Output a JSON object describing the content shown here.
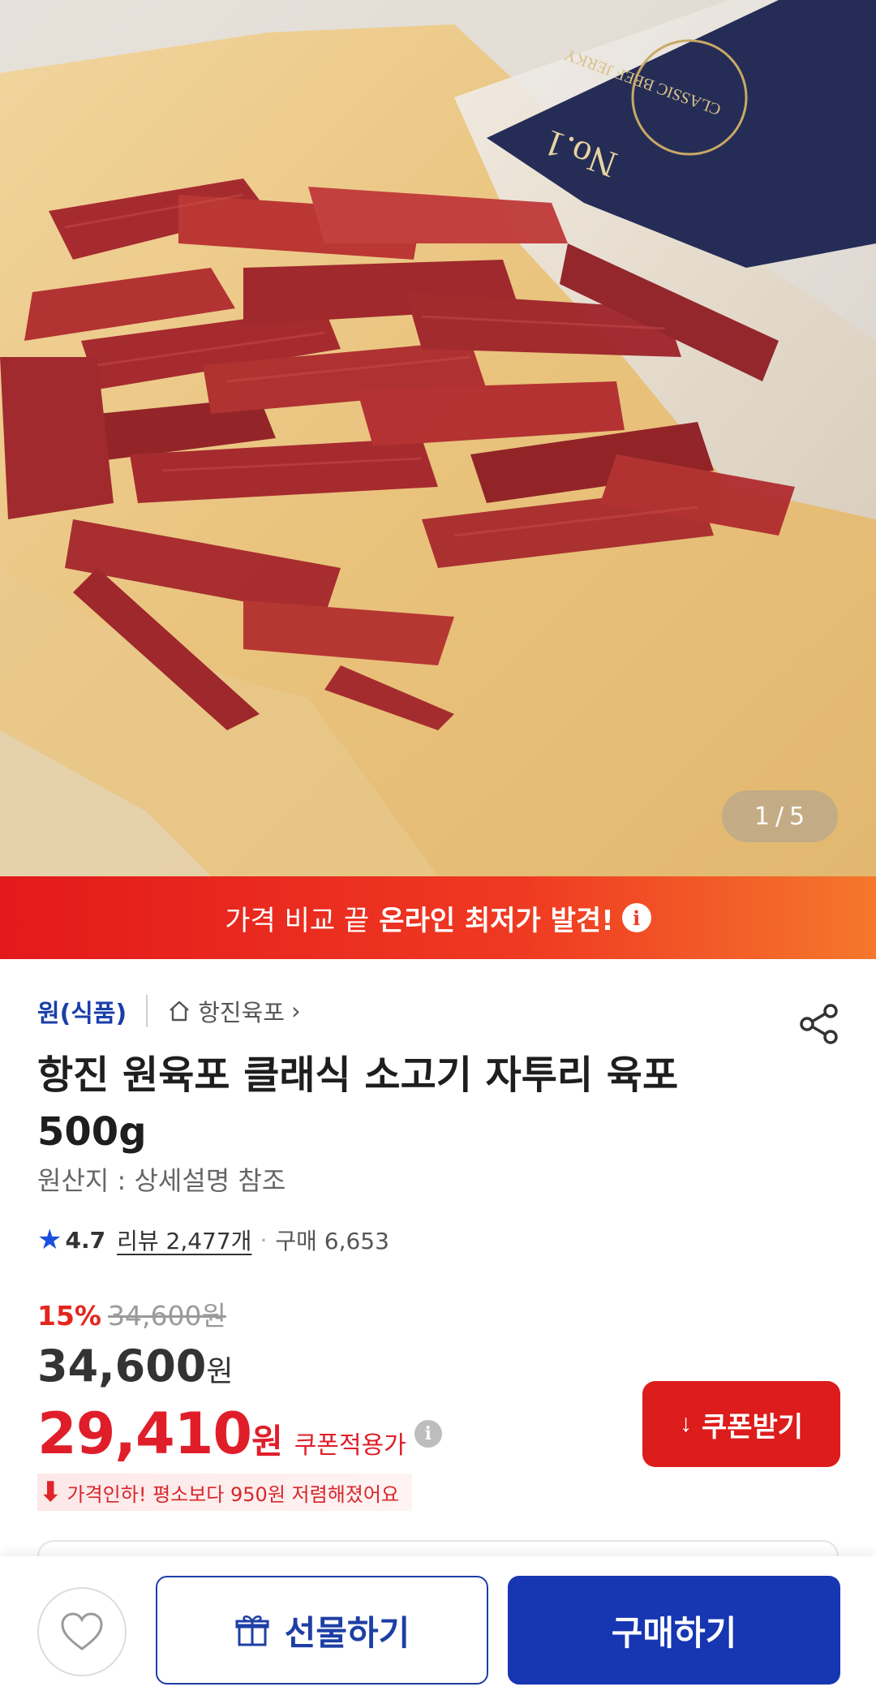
{
  "gallery": {
    "current": "1",
    "separator": "/",
    "total": "5",
    "package_text": "No.1",
    "package_subtext": "CLASSIC BEEF JERKY"
  },
  "banner": {
    "light_text": "가격 비교 끝",
    "bold_text": "온라인 최저가 발견!",
    "info_symbol": "i"
  },
  "product": {
    "seller": "원(식품)",
    "store_name": "항진육포",
    "store_chevron": "›",
    "title_line1": "항진 원육포 클래식 소고기 자투리 육포",
    "title_line2": "500g",
    "origin": "원산지 : 상세설명 참조",
    "rating": {
      "score": "4.7",
      "reviews": "리뷰 2,477개",
      "dot": "·",
      "purchases": "구매 6,653"
    },
    "pricing": {
      "discount_rate": "15%",
      "original_price": "34,600원",
      "price": "34,600",
      "price_unit": "원",
      "coupon_price": "29,410",
      "coupon_unit": "원",
      "coupon_label": "쿠폰적용가",
      "info_symbol": "i"
    },
    "coupon_button": "쿠폰받기",
    "coupon_icon": "↓",
    "price_drop_note": "가격인하! 평소보다 950원 저렴해졌어요"
  },
  "bottom_bar": {
    "gift_label": "선물하기",
    "buy_label": "구매하기"
  },
  "colors": {
    "brand_blue": "#1636b2",
    "sale_red": "#e01e2a",
    "banner_start": "#e3191b",
    "banner_end": "#f5772c"
  }
}
